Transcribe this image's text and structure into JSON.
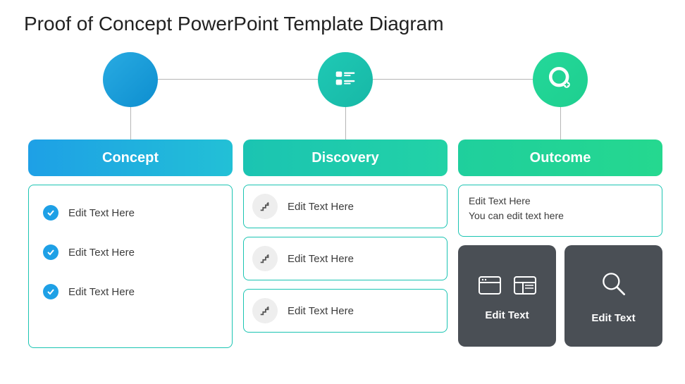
{
  "title": "Proof of Concept PowerPoint Template Diagram",
  "columns": [
    {
      "header": "Concept",
      "items": [
        "Edit Text Here",
        "Edit Text Here",
        "Edit Text Here"
      ]
    },
    {
      "header": "Discovery",
      "items": [
        "Edit Text Here",
        "Edit Text Here",
        "Edit Text Here"
      ]
    },
    {
      "header": "Outcome",
      "text1": "Edit Text Here",
      "text2": "You can edit text here",
      "tile1": "Edit Text",
      "tile2": "Edit Text"
    }
  ]
}
